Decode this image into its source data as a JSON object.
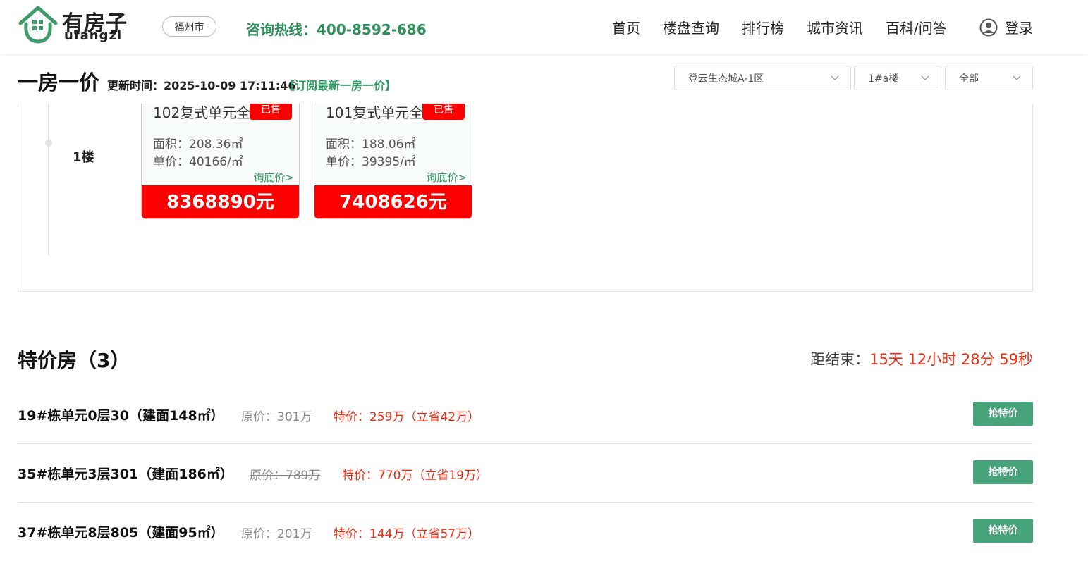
{
  "header": {
    "logo_cn": "有房子",
    "logo_en": "ufangzi",
    "city": "福州市",
    "hotline": "咨询热线：400-8592-686",
    "nav": [
      "首页",
      "楼盘查询",
      "排行榜",
      "城市资讯",
      "百科/问答"
    ],
    "login": "登录"
  },
  "section": {
    "title": "一房一价",
    "update": "更新时间：2025-10-09 17:11:46",
    "subscribe": "【订阅最新一房一价】",
    "filters": [
      "登云生态城A-1区",
      "1#a楼",
      "全部"
    ]
  },
  "building": {
    "floor_label": "1楼",
    "units": [
      {
        "name": "102复式单元全",
        "tag": "已售",
        "area": "面积：208.36㎡",
        "unit_price": "单价：40166/㎡",
        "ask": "询底价>",
        "total": "8368890元"
      },
      {
        "name": "101复式单元全",
        "tag": "已售",
        "area": "面积：188.06㎡",
        "unit_price": "单价：39395/㎡",
        "ask": "询底价>",
        "total": "7408626元"
      }
    ]
  },
  "special": {
    "title": "特价房（3）",
    "countdown_label": "距结束：",
    "countdown_value": "15天 12小时 28分 59秒",
    "items": [
      {
        "name": "19#栋单元0层30（建面148㎡）",
        "original": "原价：301万",
        "offer": "特价：259万（立省42万）",
        "button": "抢特价"
      },
      {
        "name": "35#栋单元3层301（建面186㎡）",
        "original": "原价：789万",
        "offer": "特价：770万（立省19万）",
        "button": "抢特价"
      },
      {
        "name": "37#栋单元8层805（建面95㎡）",
        "original": "原价：201万",
        "offer": "特价：144万（立省57万）",
        "button": "抢特价"
      }
    ]
  },
  "colors": {
    "brand_green": "#2f8f5b",
    "button_green": "#47a37a",
    "price_red": "#ff0000",
    "offer_red": "#f32a10"
  }
}
